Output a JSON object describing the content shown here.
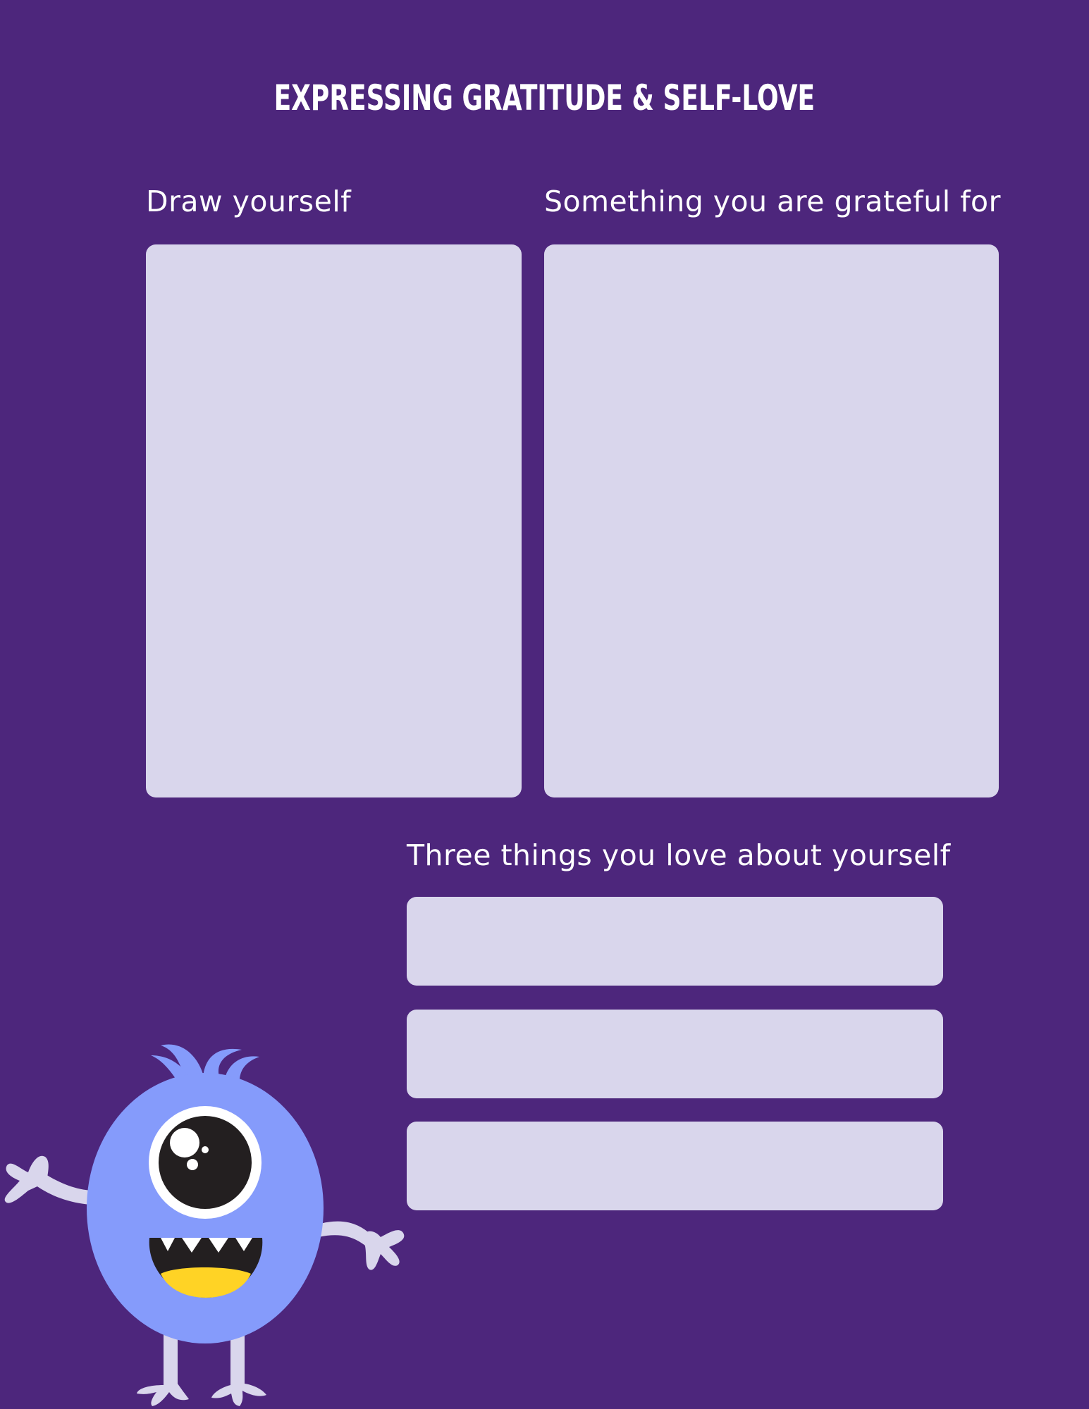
{
  "title": "EXPRESSING GRATITUDE & SELF-LOVE",
  "sections": {
    "draw_yourself": {
      "label": "Draw yourself"
    },
    "grateful_for": {
      "label": "Something you are grateful for"
    },
    "three_things": {
      "label": "Three things you love about yourself"
    }
  },
  "colors": {
    "background": "#4d267c",
    "box_fill": "#d9d6ec",
    "monster_body": "#859bfb",
    "monster_limbs": "#d9d6ec",
    "monster_mouth_tongue": "#ffd325",
    "text": "#ffffff"
  },
  "illustration": {
    "name": "one-eyed-monster"
  }
}
